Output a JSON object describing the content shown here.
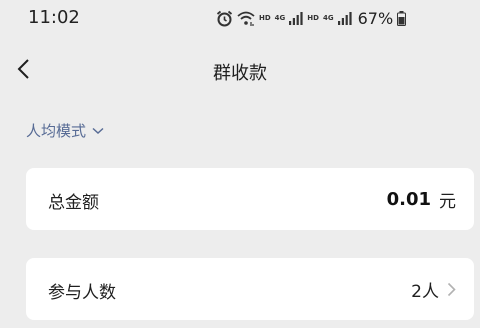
{
  "status_bar": {
    "time": "11:02",
    "hd_label_1": "HD",
    "hd_label_2": "HD",
    "net_label_1": "4G",
    "net_label_2": "4G",
    "battery": "67%"
  },
  "header": {
    "title": "群收款"
  },
  "mode_switch": {
    "label": "人均模式"
  },
  "total_amount": {
    "label": "总金额",
    "value": "0.01",
    "unit": "元"
  },
  "participants": {
    "label": "参与人数",
    "value": "2人"
  },
  "colors": {
    "background": "#ededed",
    "card": "#ffffff",
    "link": "#576b95"
  }
}
